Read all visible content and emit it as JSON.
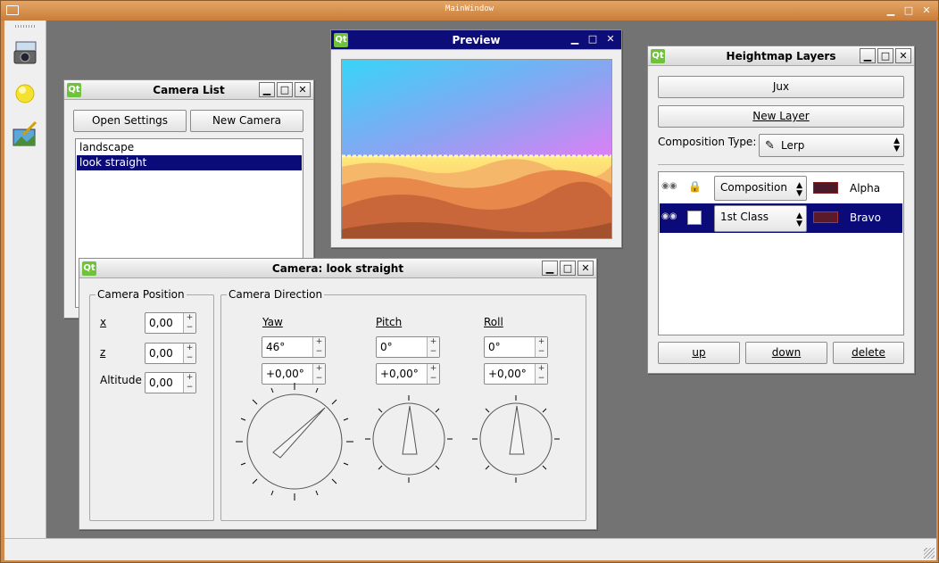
{
  "main_window": {
    "title": "MainWindow",
    "minimize": "▁",
    "maximize": "□",
    "close": "✕"
  },
  "toolbar": {
    "items": [
      {
        "icon": "camera-icon"
      },
      {
        "icon": "sun-icon"
      },
      {
        "icon": "landscape-icon"
      }
    ]
  },
  "camera_list": {
    "title": "Camera List",
    "open_settings": "Open Settings",
    "new_camera": "New Camera",
    "items": [
      "landscape",
      "look straight"
    ],
    "selected_index": 1
  },
  "preview": {
    "title": "Preview"
  },
  "heightmap": {
    "title": "Heightmap Layers",
    "jux_button": "Jux",
    "new_layer_button": "New Layer",
    "composition_label": "Composition Type:",
    "composition_value": "Lerp",
    "layers": [
      {
        "mode": "Composition",
        "name": "Alpha",
        "selected": false
      },
      {
        "mode": "1st Class",
        "name": "Bravo",
        "selected": true
      }
    ],
    "up": "up",
    "down": "down",
    "delete": "delete"
  },
  "camera": {
    "title": "Camera: look straight",
    "position_group": "Camera Position",
    "x_label": "x",
    "x_value": "0,00",
    "z_label": "z",
    "z_value": "0,00",
    "altitude_label": "Altitude",
    "altitude_value": "0,00",
    "direction_group": "Camera Direction",
    "yaw_label": "Yaw",
    "yaw_value": "46°",
    "yaw_offset": "+0,00°",
    "pitch_label": "Pitch",
    "pitch_value": "0°",
    "pitch_offset": "+0,00°",
    "roll_label": "Roll",
    "roll_value": "0°",
    "roll_offset": "+0,00°"
  },
  "colors": {
    "selection": "#0a0a78",
    "desktop": "#737373",
    "titlebar": "#d08a4a"
  }
}
